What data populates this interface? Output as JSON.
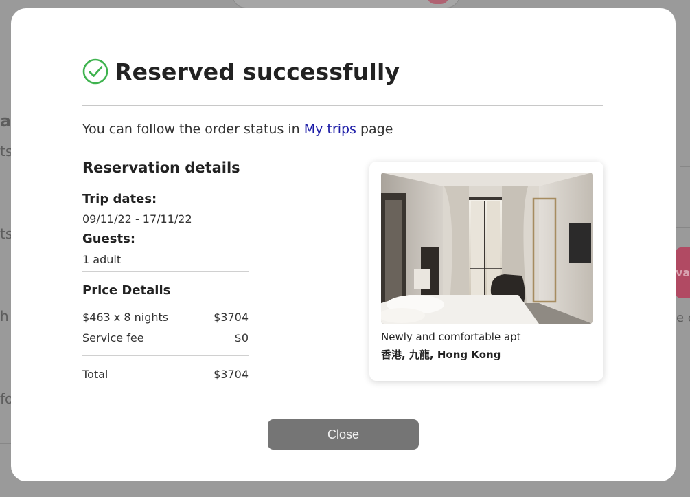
{
  "modal": {
    "title": "Reserved successfully",
    "follow_prefix": "You can follow the order status in ",
    "follow_link": "My trips",
    "follow_suffix": " page",
    "close_label": "Close"
  },
  "reservation": {
    "section_title": "Reservation details",
    "trip_dates_label": "Trip dates:",
    "trip_dates_value": "09/11/22 - 17/11/22",
    "guests_label": "Guests:",
    "guests_value": "1 adult"
  },
  "price": {
    "section_title": "Price Details",
    "rows": [
      {
        "label": "$463 x 8 nights",
        "amount": "$3704"
      },
      {
        "label": "Service fee",
        "amount": "$0"
      }
    ],
    "total_label": "Total",
    "total_amount": "$3704"
  },
  "listing": {
    "name": "Newly and comfortable apt",
    "location": "香港, 九龍, Hong Kong",
    "image_icon": "hotel-room-photo"
  },
  "background": {
    "fragments": [
      "at",
      "ts",
      "ts",
      "h",
      "fo",
      "va",
      "e c"
    ]
  },
  "colors": {
    "success_green": "#3fb34f",
    "link_blue": "#1a1aa6",
    "close_button": "#757575",
    "backdrop": "#8f8f8f"
  }
}
